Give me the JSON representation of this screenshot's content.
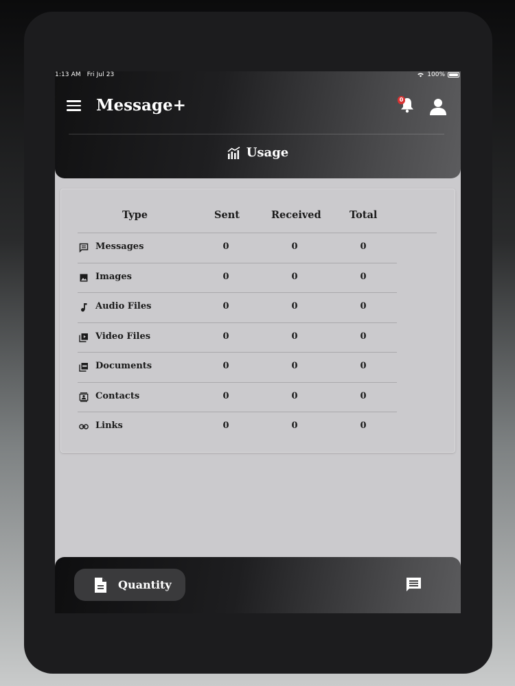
{
  "status_bar": {
    "time": "1:13 AM",
    "date": "Fri Jul 23",
    "battery": "100%"
  },
  "header": {
    "title": "Message+",
    "notification_count": "0",
    "section_title": "Usage"
  },
  "table": {
    "columns": [
      "Type",
      "Sent",
      "Received",
      "Total"
    ],
    "rows": [
      {
        "icon": "message-icon",
        "type": "Messages",
        "sent": "0",
        "received": "0",
        "total": "0"
      },
      {
        "icon": "image-icon",
        "type": "Images",
        "sent": "0",
        "received": "0",
        "total": "0"
      },
      {
        "icon": "music-note-icon",
        "type": "Audio Files",
        "sent": "0",
        "received": "0",
        "total": "0"
      },
      {
        "icon": "video-library-icon",
        "type": "Video Files",
        "sent": "0",
        "received": "0",
        "total": "0"
      },
      {
        "icon": "pdf-icon",
        "type": "Documents",
        "sent": "0",
        "received": "0",
        "total": "0"
      },
      {
        "icon": "contact-card-icon",
        "type": "Contacts",
        "sent": "0",
        "received": "0",
        "total": "0"
      },
      {
        "icon": "link-icon",
        "type": "Links",
        "sent": "0",
        "received": "0",
        "total": "0"
      }
    ]
  },
  "bottom_nav": {
    "quantity_label": "Quantity"
  }
}
